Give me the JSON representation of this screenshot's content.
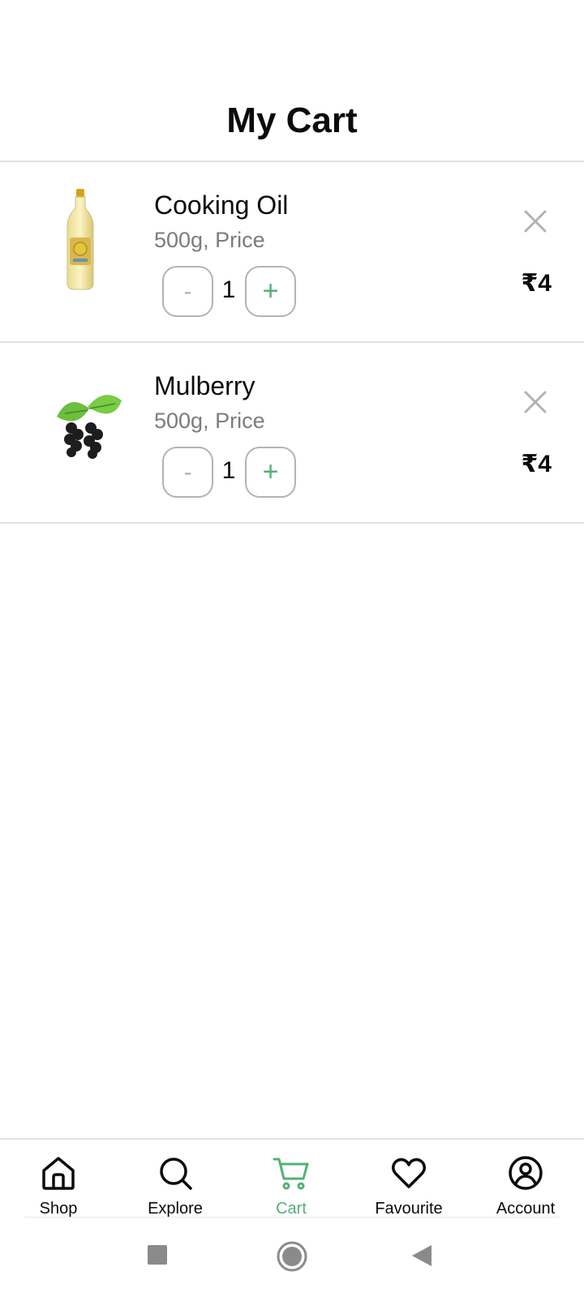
{
  "header": {
    "title": "My Cart"
  },
  "cart": {
    "items": [
      {
        "name": "Cooking Oil",
        "description": "500g, Price",
        "quantity": "1",
        "price": "₹4",
        "minus_label": "-",
        "plus_label": "+",
        "image_icon": "cooking-oil-bottle"
      },
      {
        "name": "Mulberry",
        "description": "500g, Price",
        "quantity": "1",
        "price": "₹4",
        "minus_label": "-",
        "plus_label": "+",
        "image_icon": "mulberry-fruit"
      }
    ]
  },
  "bottom_nav": {
    "items": [
      {
        "label": "Shop",
        "icon": "home-icon"
      },
      {
        "label": "Explore",
        "icon": "search-icon"
      },
      {
        "label": "Cart",
        "icon": "cart-icon",
        "active": true
      },
      {
        "label": "Favourite",
        "icon": "heart-icon"
      },
      {
        "label": "Account",
        "icon": "account-icon"
      }
    ]
  },
  "colors": {
    "accent": "#53b175",
    "text": "#0b0b0b",
    "muted": "#7c7c7c",
    "border": "#e2e2e2"
  }
}
